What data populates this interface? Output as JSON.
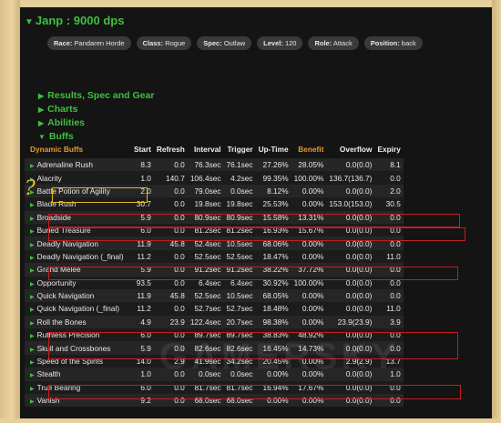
{
  "character": {
    "title": "Janp : 9000 dps",
    "chips": [
      {
        "label": "Race:",
        "value": "Pandaren Horde"
      },
      {
        "label": "Class:",
        "value": "Rogue"
      },
      {
        "label": "Spec:",
        "value": "Outlaw"
      },
      {
        "label": "Level:",
        "value": "120"
      },
      {
        "label": "Role:",
        "value": "Attack"
      },
      {
        "label": "Position:",
        "value": "back"
      }
    ]
  },
  "nav": [
    {
      "label": "Results, Spec and Gear"
    },
    {
      "label": "Charts"
    },
    {
      "label": "Abilities"
    },
    {
      "label": "Buffs"
    }
  ],
  "table": {
    "headers": [
      "Dynamic Buffs",
      "Start",
      "Refresh",
      "Interval",
      "Trigger",
      "Up-Time",
      "Benefit",
      "Overflow",
      "Expiry"
    ],
    "rows": [
      [
        "Adrenaline Rush",
        "8.3",
        "0.0",
        "76.3sec",
        "76.1sec",
        "27.26%",
        "28.05%",
        "0.0(0.0)",
        "8.1"
      ],
      [
        "Alacrity",
        "1.0",
        "140.7",
        "106.4sec",
        "4.2sec",
        "99.35%",
        "100.00%",
        "136.7(136.7)",
        "0.0"
      ],
      [
        "Battle Potion of Agility",
        "2.0",
        "0.0",
        "79.0sec",
        "0.0sec",
        "8.12%",
        "0.00%",
        "0.0(0.0)",
        "2.0"
      ],
      [
        "Blade Rush",
        "30.7",
        "0.0",
        "19.8sec",
        "19.8sec",
        "25.53%",
        "0.00%",
        "153.0(153.0)",
        "30.5"
      ],
      [
        "Broadside",
        "5.9",
        "0.0",
        "80.9sec",
        "80.9sec",
        "15.58%",
        "13.31%",
        "0.0(0.0)",
        "0.0"
      ],
      [
        "Buried Treasure",
        "6.0",
        "0.0",
        "81.2sec",
        "81.2sec",
        "16.93%",
        "15.67%",
        "0.0(0.0)",
        "0.0"
      ],
      [
        "Deadly Navigation",
        "11.9",
        "45.8",
        "52.4sec",
        "10.5sec",
        "68.06%",
        "0.00%",
        "0.0(0.0)",
        "0.0"
      ],
      [
        "Deadly Navigation (_final)",
        "11.2",
        "0.0",
        "52.5sec",
        "52.5sec",
        "18.47%",
        "0.00%",
        "0.0(0.0)",
        "11.0"
      ],
      [
        "Grand Melee",
        "5.9",
        "0.0",
        "91.2sec",
        "91.2sec",
        "38.22%",
        "37.72%",
        "0.0(0.0)",
        "0.0"
      ],
      [
        "Opportunity",
        "93.5",
        "0.0",
        "6.4sec",
        "6.4sec",
        "30.92%",
        "100.00%",
        "0.0(0.0)",
        "0.0"
      ],
      [
        "Quick Navigation",
        "11.9",
        "45.8",
        "52.5sec",
        "10.5sec",
        "68.05%",
        "0.00%",
        "0.0(0.0)",
        "0.0"
      ],
      [
        "Quick Navigation (_final)",
        "11.2",
        "0.0",
        "52.7sec",
        "52.7sec",
        "18.48%",
        "0.00%",
        "0.0(0.0)",
        "11.0"
      ],
      [
        "Roll the Bones",
        "4.9",
        "23.9",
        "122.4sec",
        "20.7sec",
        "98.38%",
        "0.00%",
        "23.9(23.9)",
        "3.9"
      ],
      [
        "Ruthless Precision",
        "6.0",
        "0.0",
        "89.7sec",
        "89.7sec",
        "38.83%",
        "48.92%",
        "0.0(0.0)",
        "0.0"
      ],
      [
        "Skull and Crossbones",
        "5.9",
        "0.0",
        "82.6sec",
        "82.6sec",
        "16.45%",
        "14.73%",
        "0.0(0.0)",
        "0.0"
      ],
      [
        "Speed of the Spirits",
        "14.0",
        "2.9",
        "41.9sec",
        "34.2sec",
        "20.45%",
        "0.00%",
        "2.9(2.9)",
        "13.7"
      ],
      [
        "Stealth",
        "1.0",
        "0.0",
        "0.0sec",
        "0.0sec",
        "0.00%",
        "0.00%",
        "0.0(0.0)",
        "1.0"
      ],
      [
        "True Bearing",
        "6.0",
        "0.0",
        "81.7sec",
        "81.7sec",
        "16.94%",
        "17.67%",
        "0.0(0.0)",
        "0.0"
      ],
      [
        "Vanish",
        "9.2",
        "0.0",
        "68.0sec",
        "68.0sec",
        "0.00%",
        "0.00%",
        "0.0(0.0)",
        "0.0"
      ]
    ]
  },
  "annotation": {
    "qmark": "?"
  },
  "colors": {
    "accent_green": "#3fbf3f",
    "header_orange": "#e89a2c",
    "highlight_red": "#c41e1e",
    "highlight_yellow": "#e0b828"
  }
}
